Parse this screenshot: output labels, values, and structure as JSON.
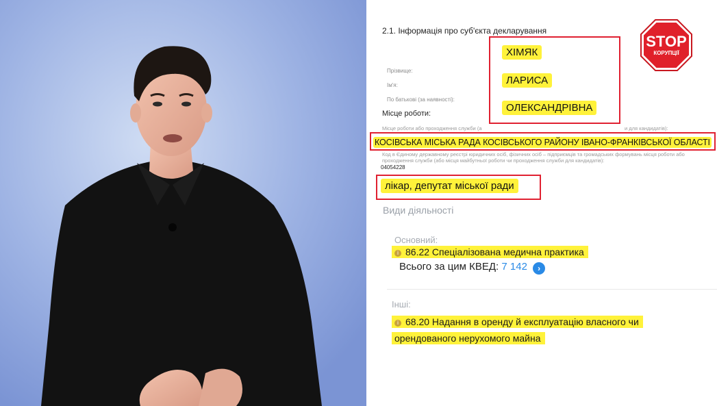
{
  "document": {
    "section_title": "2.1. Інформація про суб'єкта декларування",
    "field_labels": {
      "surname": "Прізвище:",
      "name": "Ім'я:",
      "patronymic": "По батькові (за наявності):"
    },
    "values": {
      "surname": "ХІМЯК",
      "name": "ЛАРИСА",
      "patronymic": "ОЛЕКСАНДРІВНА"
    },
    "workplace_heading": "Місце роботи:",
    "workplace_hint_left": "Місце роботи або проходження служби (а",
    "workplace_hint_right": "и для кандидатів):",
    "organization": "КОСІВСЬКА МІСЬКА РАДА КОСІВСЬКОГО РАЙОНУ ІВАНО-ФРАНКІВСЬКОЇ ОБЛАСТІ",
    "code_hint_line1": "Код в Єдиному державному реєстрі юридичних осіб, фізичних осіб – підприємців та громадських формувань місця роботи або",
    "code_hint_line2": "проходження служби (або місця майбутньої роботи чи проходження служби для кандидатів):",
    "code_value": "04054228",
    "position": "лікар, депутат міської ради"
  },
  "activities": {
    "title": "Види діяльності",
    "main_label": "Основний:",
    "main_kved": "86.22 Спеціалізована медична практика",
    "total_label": "Всього за цим КВЕД:",
    "total_count": "7 142",
    "other_label": "Інші:",
    "other_kved_line1": "68.20 Надання в оренду й експлуатацію власного чи",
    "other_kved_line2": "орендованого нерухомого майна"
  },
  "badge": {
    "line1": "STOP",
    "line2": "КОРУПЦІЇ",
    "color": "#e0202a"
  },
  "colors": {
    "highlight": "#fff23a",
    "red_box": "#e02030",
    "link": "#2a8ae6"
  },
  "icons": [
    "info-icon",
    "chevron-right-icon",
    "stop-sign-icon"
  ]
}
